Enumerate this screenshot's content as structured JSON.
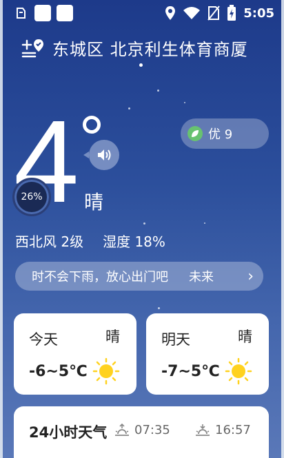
{
  "status_bar": {
    "time": "5:05"
  },
  "header": {
    "location": "东城区 北京利生体育商厦"
  },
  "current": {
    "temperature": "4",
    "condition": "晴",
    "progress_badge": "26%",
    "aqi_label": "优 9",
    "wind": "西北风 2级",
    "humidity": "湿度 18%",
    "notice_text": "时不会下雨，放心出门吧",
    "notice_more": "未来",
    "notice_chevron": "›"
  },
  "forecast": [
    {
      "day": "今天",
      "condition": "晴",
      "range": "-6~5℃"
    },
    {
      "day": "明天",
      "condition": "晴",
      "range": "-7~5℃"
    }
  ],
  "hourly": {
    "title": "24小时天气",
    "sunrise": "07:35",
    "sunset": "16:57"
  },
  "colors": {
    "sun": "#ffd21f",
    "aqi_leaf": "#68c270",
    "bg_top": "#1d3a8a",
    "bg_bottom": "#5a78b8"
  }
}
